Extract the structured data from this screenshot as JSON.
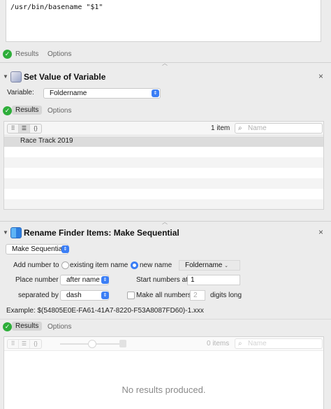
{
  "shell": {
    "code": "/usr/bin/basename \"$1\""
  },
  "shell_footer": {
    "results": "Results",
    "options": "Options"
  },
  "set_value": {
    "title": "Set Value of Variable",
    "variable_label": "Variable:",
    "variable_value": "Foldername",
    "results": "Results",
    "options": "Options",
    "count": "1 item",
    "search_placeholder": "Name",
    "rows": [
      "Race Track 2019"
    ]
  },
  "rename": {
    "title": "Rename Finder Items: Make Sequential",
    "mode": "Make Sequential",
    "add_number_label": "Add number to",
    "existing_item_name": "existing item name",
    "new_name": "new name",
    "new_name_value": "Foldername",
    "place_number_label": "Place number",
    "place_number_value": "after name",
    "start_numbers_label": "Start numbers at",
    "start_numbers_value": "1",
    "separated_by_label": "separated by",
    "separated_by_value": "dash",
    "make_all_label": "Make all numbers",
    "digits_value": "2",
    "digits_long_label": "digits long",
    "example": "Example:   $(54805E0E-FA61-41A7-8220-F53A8087FD60)-1.xxx",
    "results": "Results",
    "options": "Options",
    "count": "0 items",
    "search_placeholder": "Name",
    "empty_message": "No results produced."
  },
  "colors": {
    "accent": "#3b7ef5",
    "success": "#2eae3a",
    "selected_row": "#dcdcdc"
  }
}
